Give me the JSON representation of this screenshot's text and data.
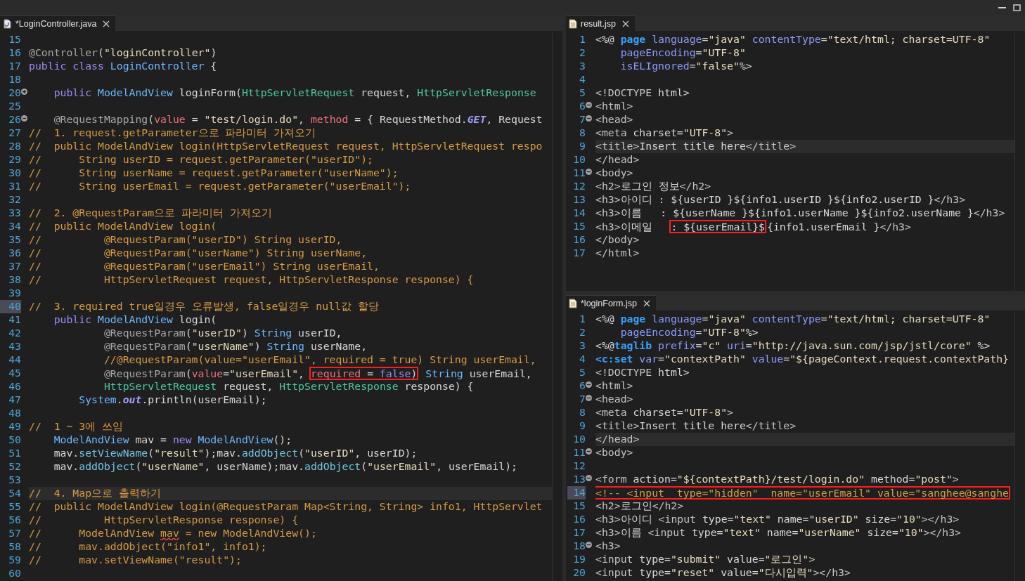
{
  "editors": [
    {
      "tab": {
        "title": "*LoginController.java",
        "kind": "java"
      },
      "lines": [
        {
          "n": "15",
          "kind": "plain",
          "highlighted": false,
          "marked": false
        },
        {
          "n": "16",
          "kind": "plain",
          "highlighted": false,
          "marked": false,
          "tokens": [
            {
              "kind": "annotation",
              "text": "@Controller"
            },
            {
              "kind": "plain",
              "text": "("
            },
            {
              "kind": "string",
              "text": "\"loginController\""
            },
            {
              "kind": "plain",
              "text": ")"
            }
          ]
        },
        {
          "n": "17",
          "kind": "plain",
          "highlighted": false,
          "marked": false,
          "tokens": [
            {
              "kind": "keyword",
              "text": "public class"
            },
            {
              "kind": "type",
              "text": " LoginController"
            },
            {
              "kind": "plain",
              "text": " {"
            }
          ]
        },
        {
          "n": "18",
          "kind": "plain",
          "highlighted": false,
          "marked": false
        },
        {
          "n": "20",
          "kind": "folded",
          "highlighted": false,
          "marked": false,
          "tokens": [
            {
              "kind": "keyword",
              "text": "    public"
            },
            {
              "kind": "type",
              "text": " ModelAndView"
            },
            {
              "kind": "plain",
              "text": " loginForm("
            },
            {
              "kind": "iface",
              "text": "HttpServletRequest"
            },
            {
              "kind": "plain",
              "text": " request, "
            },
            {
              "kind": "iface",
              "text": "HttpServletResponse"
            }
          ]
        },
        {
          "n": "25",
          "kind": "plain",
          "highlighted": false,
          "marked": false
        },
        {
          "n": "26",
          "kind": "foldable",
          "highlighted": false,
          "marked": false,
          "tokens": [
            {
              "kind": "annotation",
              "text": "    @RequestMapping"
            },
            {
              "kind": "plain",
              "text": "("
            },
            {
              "kind": "param",
              "text": "value"
            },
            {
              "kind": "plain",
              "text": " = "
            },
            {
              "kind": "string",
              "text": "\"test/login.do\""
            },
            {
              "kind": "plain",
              "text": ", "
            },
            {
              "kind": "param",
              "text": "method"
            },
            {
              "kind": "plain",
              "text": " = { RequestMethod."
            },
            {
              "kind": "field",
              "text": "GET"
            },
            {
              "kind": "plain",
              "text": ", Request"
            }
          ]
        },
        {
          "n": "27",
          "kind": "plain",
          "highlighted": false,
          "marked": false,
          "tokens": [
            {
              "kind": "comment",
              "text": "//  1. request.getParameter으로 파라미터 가져오기"
            }
          ]
        },
        {
          "n": "28",
          "kind": "plain",
          "highlighted": false,
          "marked": false,
          "tokens": [
            {
              "kind": "comment",
              "text": "//  public ModelAndView login(HttpServletRequest request, HttpServletRequest respo"
            }
          ]
        },
        {
          "n": "29",
          "kind": "plain",
          "highlighted": false,
          "marked": false,
          "tokens": [
            {
              "kind": "comment",
              "text": "//      String userID = request.getParameter(\"userID\");"
            }
          ]
        },
        {
          "n": "30",
          "kind": "plain",
          "highlighted": false,
          "marked": false,
          "tokens": [
            {
              "kind": "comment",
              "text": "//      String userName = request.getParameter(\"userName\");"
            }
          ]
        },
        {
          "n": "31",
          "kind": "plain",
          "highlighted": false,
          "marked": false,
          "tokens": [
            {
              "kind": "comment",
              "text": "//      String userEmail = request.getParameter(\"userEmail\");"
            }
          ]
        },
        {
          "n": "32",
          "kind": "plain",
          "highlighted": false,
          "marked": false
        },
        {
          "n": "33",
          "kind": "plain",
          "highlighted": false,
          "marked": false,
          "tokens": [
            {
              "kind": "comment",
              "text": "//  2. @RequestParam으로 파라미터 가져오기"
            }
          ]
        },
        {
          "n": "34",
          "kind": "plain",
          "highlighted": false,
          "marked": false,
          "tokens": [
            {
              "kind": "comment",
              "text": "//  public ModelAndView login("
            }
          ]
        },
        {
          "n": "35",
          "kind": "plain",
          "highlighted": false,
          "marked": false,
          "tokens": [
            {
              "kind": "comment",
              "text": "//          @RequestParam(\"userID\") String userID,"
            }
          ]
        },
        {
          "n": "36",
          "kind": "plain",
          "highlighted": false,
          "marked": false,
          "tokens": [
            {
              "kind": "comment",
              "text": "//          @RequestParam(\"userName\") String userName,"
            }
          ]
        },
        {
          "n": "37",
          "kind": "plain",
          "highlighted": false,
          "marked": false,
          "tokens": [
            {
              "kind": "comment",
              "text": "//          @RequestParam(\"userEmail\") String userEmail,"
            }
          ]
        },
        {
          "n": "38",
          "kind": "plain",
          "highlighted": false,
          "marked": false,
          "tokens": [
            {
              "kind": "comment",
              "text": "//          HttpServletRequest request, HttpServletResponse response) {"
            }
          ]
        },
        {
          "n": "39",
          "kind": "plain",
          "highlighted": false,
          "marked": false
        },
        {
          "n": "40",
          "kind": "plain",
          "highlighted": false,
          "marked": true,
          "tokens": [
            {
              "kind": "comment",
              "text": "//  3. required true일경우 오류발생, false일경우 null값 할당"
            }
          ]
        },
        {
          "n": "41",
          "kind": "plain",
          "highlighted": false,
          "marked": false,
          "tokens": [
            {
              "kind": "keyword",
              "text": "    public"
            },
            {
              "kind": "type",
              "text": " ModelAndView"
            },
            {
              "kind": "plain",
              "text": " login("
            }
          ]
        },
        {
          "n": "42",
          "kind": "plain",
          "highlighted": false,
          "marked": false,
          "tokens": [
            {
              "kind": "annotation",
              "text": "            @RequestParam"
            },
            {
              "kind": "plain",
              "text": "("
            },
            {
              "kind": "string",
              "text": "\"userID\""
            },
            {
              "kind": "plain",
              "text": ") "
            },
            {
              "kind": "type",
              "text": "String"
            },
            {
              "kind": "plain",
              "text": " userID,"
            }
          ]
        },
        {
          "n": "43",
          "kind": "plain",
          "highlighted": false,
          "marked": false,
          "tokens": [
            {
              "kind": "annotation",
              "text": "            @RequestParam"
            },
            {
              "kind": "plain",
              "text": "("
            },
            {
              "kind": "string",
              "text": "\"userName\""
            },
            {
              "kind": "plain",
              "text": ") "
            },
            {
              "kind": "type",
              "text": "String"
            },
            {
              "kind": "plain",
              "text": " userName,"
            }
          ]
        },
        {
          "n": "44",
          "kind": "plain",
          "highlighted": false,
          "marked": false,
          "tokens": [
            {
              "kind": "comment",
              "text": "            //@RequestParam(value=\"userEmail\", required = true) String userEmail,"
            }
          ]
        },
        {
          "n": "45",
          "kind": "plain",
          "highlighted": false,
          "marked": false,
          "tokens": [
            {
              "kind": "annotation",
              "text": "            @RequestParam"
            },
            {
              "kind": "plain",
              "text": "("
            },
            {
              "kind": "param",
              "text": "value"
            },
            {
              "kind": "plain",
              "text": "="
            },
            {
              "kind": "string",
              "text": "\"userEmail\""
            },
            {
              "kind": "plain",
              "text": ", "
            },
            {
              "kind": "box",
              "tokens": [
                {
                  "kind": "param",
                  "text": "required"
                },
                {
                  "kind": "plain",
                  "text": " = "
                },
                {
                  "kind": "keyword",
                  "text": "false"
                },
                {
                  "kind": "plain",
                  "text": ")"
                }
              ]
            },
            {
              "kind": "type",
              "text": " String"
            },
            {
              "kind": "plain",
              "text": " userEmail,"
            }
          ]
        },
        {
          "n": "46",
          "kind": "plain",
          "highlighted": false,
          "marked": false,
          "tokens": [
            {
              "kind": "iface",
              "text": "            HttpServletRequest"
            },
            {
              "kind": "plain",
              "text": " request, "
            },
            {
              "kind": "iface",
              "text": "HttpServletResponse"
            },
            {
              "kind": "plain",
              "text": " response) {"
            }
          ]
        },
        {
          "n": "47",
          "kind": "plain",
          "highlighted": false,
          "marked": false,
          "tokens": [
            {
              "kind": "type",
              "text": "        System"
            },
            {
              "kind": "plain",
              "text": "."
            },
            {
              "kind": "field",
              "text": "out"
            },
            {
              "kind": "plain",
              "text": ".println(userEmail);"
            }
          ]
        },
        {
          "n": "48",
          "kind": "plain",
          "highlighted": false,
          "marked": false
        },
        {
          "n": "49",
          "kind": "plain",
          "highlighted": false,
          "marked": false,
          "tokens": [
            {
              "kind": "comment",
              "text": "//  1 ~ 3에 쓰임"
            }
          ]
        },
        {
          "n": "50",
          "kind": "plain",
          "highlighted": false,
          "marked": false,
          "tokens": [
            {
              "kind": "type",
              "text": "    ModelAndView"
            },
            {
              "kind": "plain",
              "text": " mav = "
            },
            {
              "kind": "keyword",
              "text": "new"
            },
            {
              "kind": "type",
              "text": " ModelAndView"
            },
            {
              "kind": "plain",
              "text": "();"
            }
          ]
        },
        {
          "n": "51",
          "kind": "plain",
          "highlighted": false,
          "marked": false,
          "tokens": [
            {
              "kind": "plain",
              "text": "    mav."
            },
            {
              "kind": "method",
              "text": "setViewName"
            },
            {
              "kind": "plain",
              "text": "("
            },
            {
              "kind": "string",
              "text": "\"result\""
            },
            {
              "kind": "plain",
              "text": ");mav."
            },
            {
              "kind": "method",
              "text": "addObject"
            },
            {
              "kind": "plain",
              "text": "("
            },
            {
              "kind": "string",
              "text": "\"userID\""
            },
            {
              "kind": "plain",
              "text": ", userID);"
            }
          ]
        },
        {
          "n": "52",
          "kind": "plain",
          "highlighted": false,
          "marked": false,
          "tokens": [
            {
              "kind": "plain",
              "text": "    mav."
            },
            {
              "kind": "method",
              "text": "addObject"
            },
            {
              "kind": "plain",
              "text": "("
            },
            {
              "kind": "string",
              "text": "\"userName\""
            },
            {
              "kind": "plain",
              "text": ", userName);mav."
            },
            {
              "kind": "method",
              "text": "addObject"
            },
            {
              "kind": "plain",
              "text": "("
            },
            {
              "kind": "string",
              "text": "\"userEmail\""
            },
            {
              "kind": "plain",
              "text": ", userEmail);"
            }
          ]
        },
        {
          "n": "53",
          "kind": "plain",
          "highlighted": false,
          "marked": false
        },
        {
          "n": "54",
          "kind": "plain",
          "highlighted": true,
          "marked": false,
          "tokens": [
            {
              "kind": "comment",
              "text": "//  4. Map으로 출력하기"
            }
          ]
        },
        {
          "n": "55",
          "kind": "plain",
          "highlighted": false,
          "marked": false,
          "tokens": [
            {
              "kind": "comment",
              "text": "//  public ModelAndView login(@RequestParam Map<String, String> info1, HttpServlet"
            }
          ]
        },
        {
          "n": "56",
          "kind": "plain",
          "highlighted": false,
          "marked": false,
          "tokens": [
            {
              "kind": "comment",
              "text": "//          HttpServletResponse response) {"
            }
          ]
        },
        {
          "n": "57",
          "kind": "plain",
          "highlighted": false,
          "marked": false,
          "tokens": [
            {
              "kind": "comment",
              "text": "//      ModelAndView "
            },
            {
              "kind": "squiggle",
              "text": "mav"
            },
            {
              "kind": "comment",
              "text": " = new ModelAndView();"
            }
          ]
        },
        {
          "n": "58",
          "kind": "plain",
          "highlighted": false,
          "marked": false,
          "tokens": [
            {
              "kind": "comment",
              "text": "//      mav.addObject(\"info1\", info1);"
            }
          ]
        },
        {
          "n": "59",
          "kind": "plain",
          "highlighted": false,
          "marked": false,
          "tokens": [
            {
              "kind": "comment",
              "text": "//      mav.setViewName(\"result\");"
            }
          ]
        },
        {
          "n": "60",
          "kind": "plain",
          "highlighted": false,
          "marked": false
        }
      ]
    },
    {
      "tab": {
        "title": "result.jsp",
        "kind": "jsp"
      },
      "lines": [
        {
          "n": "1",
          "kind": "plain",
          "highlighted": false,
          "marked": false,
          "tokens": [
            {
              "kind": "plain",
              "text": "<%@ "
            },
            {
              "kind": "directive",
              "text": "page"
            },
            {
              "kind": "attr",
              "text": " language"
            },
            {
              "kind": "plain",
              "text": "="
            },
            {
              "kind": "string",
              "text": "\"java\""
            },
            {
              "kind": "attr",
              "text": " contentType"
            },
            {
              "kind": "plain",
              "text": "="
            },
            {
              "kind": "string",
              "text": "\"text/html; charset=UTF-8\""
            }
          ]
        },
        {
          "n": "2",
          "kind": "plain",
          "highlighted": false,
          "marked": false,
          "tokens": [
            {
              "kind": "attr",
              "text": "    pageEncoding"
            },
            {
              "kind": "plain",
              "text": "="
            },
            {
              "kind": "string",
              "text": "\"UTF-8\""
            }
          ]
        },
        {
          "n": "3",
          "kind": "plain",
          "highlighted": false,
          "marked": false,
          "tokens": [
            {
              "kind": "attr",
              "text": "    isELIgnored"
            },
            {
              "kind": "plain",
              "text": "="
            },
            {
              "kind": "string",
              "text": "\"false\""
            },
            {
              "kind": "plain",
              "text": "%>"
            }
          ]
        },
        {
          "n": "4",
          "kind": "plain",
          "highlighted": false,
          "marked": false
        },
        {
          "n": "5",
          "kind": "plain",
          "highlighted": false,
          "marked": false,
          "tokens": [
            {
              "kind": "tag",
              "text": "<!DOCTYPE"
            },
            {
              "kind": "plain",
              "text": " html>"
            }
          ]
        },
        {
          "n": "6",
          "kind": "foldable",
          "highlighted": false,
          "marked": false,
          "tokens": [
            {
              "kind": "tag",
              "text": "<html>"
            }
          ]
        },
        {
          "n": "7",
          "kind": "foldable",
          "highlighted": false,
          "marked": false,
          "tokens": [
            {
              "kind": "tag",
              "text": "<head>"
            }
          ]
        },
        {
          "n": "8",
          "kind": "plain",
          "highlighted": false,
          "marked": false,
          "tokens": [
            {
              "kind": "tag",
              "text": "<meta"
            },
            {
              "kind": "plain",
              "text": " charset="
            },
            {
              "kind": "string",
              "text": "\"UTF-8\""
            },
            {
              "kind": "tag",
              "text": ">"
            }
          ]
        },
        {
          "n": "9",
          "kind": "plain",
          "highlighted": true,
          "marked": false,
          "tokens": [
            {
              "kind": "tag",
              "text": "<title>"
            },
            {
              "kind": "plain",
              "text": "Insert title here"
            },
            {
              "kind": "tag",
              "text": "</title>"
            }
          ]
        },
        {
          "n": "10",
          "kind": "plain",
          "highlighted": false,
          "marked": false,
          "tokens": [
            {
              "kind": "tag",
              "text": "</head>"
            }
          ]
        },
        {
          "n": "11",
          "kind": "foldable",
          "highlighted": false,
          "marked": false,
          "tokens": [
            {
              "kind": "tag",
              "text": "<body>"
            }
          ]
        },
        {
          "n": "12",
          "kind": "plain",
          "highlighted": false,
          "marked": false,
          "tokens": [
            {
              "kind": "tag",
              "text": "<h2>"
            },
            {
              "kind": "plain",
              "text": "로그인 정보"
            },
            {
              "kind": "tag",
              "text": "</h2>"
            }
          ]
        },
        {
          "n": "13",
          "kind": "plain",
          "highlighted": false,
          "marked": false,
          "tokens": [
            {
              "kind": "tag",
              "text": "<h3>"
            },
            {
              "kind": "plain",
              "text": "아이디 : ${userID }${info1.userID }${info2.userID }"
            },
            {
              "kind": "tag",
              "text": "</h3>"
            }
          ]
        },
        {
          "n": "14",
          "kind": "plain",
          "highlighted": false,
          "marked": false,
          "tokens": [
            {
              "kind": "tag",
              "text": "<h3>"
            },
            {
              "kind": "plain",
              "text": "이름   : ${userName }${info1.userName }${info2.userName }"
            },
            {
              "kind": "tag",
              "text": "</h3>"
            }
          ]
        },
        {
          "n": "15",
          "kind": "plain",
          "highlighted": false,
          "marked": false,
          "tokens": [
            {
              "kind": "tag",
              "text": "<h3>"
            },
            {
              "kind": "plain",
              "text": "이메일   "
            },
            {
              "kind": "box",
              "tokens": [
                {
                  "kind": "plain",
                  "text": ": ${userEmail}$"
                }
              ]
            },
            {
              "kind": "plain",
              "text": "{info1.userEmail }"
            },
            {
              "kind": "tag",
              "text": "</h3>"
            }
          ]
        },
        {
          "n": "16",
          "kind": "plain",
          "highlighted": false,
          "marked": false,
          "tokens": [
            {
              "kind": "tag",
              "text": "</body>"
            }
          ]
        },
        {
          "n": "17",
          "kind": "plain",
          "highlighted": false,
          "marked": false,
          "tokens": [
            {
              "kind": "tag",
              "text": "</html>"
            }
          ]
        }
      ]
    },
    {
      "tab": {
        "title": "*loginForm.jsp",
        "kind": "jsp"
      },
      "lines": [
        {
          "n": "1",
          "kind": "plain",
          "highlighted": false,
          "marked": false,
          "tokens": [
            {
              "kind": "plain",
              "text": "<%@ "
            },
            {
              "kind": "directive",
              "text": "page"
            },
            {
              "kind": "attr",
              "text": " language"
            },
            {
              "kind": "plain",
              "text": "="
            },
            {
              "kind": "string",
              "text": "\"java\""
            },
            {
              "kind": "attr",
              "text": " contentType"
            },
            {
              "kind": "plain",
              "text": "="
            },
            {
              "kind": "string",
              "text": "\"text/html; charset=UTF-8\""
            }
          ]
        },
        {
          "n": "2",
          "kind": "plain",
          "highlighted": false,
          "marked": false,
          "tokens": [
            {
              "kind": "attr",
              "text": "    pageEncoding"
            },
            {
              "kind": "plain",
              "text": "="
            },
            {
              "kind": "string",
              "text": "\"UTF-8\""
            },
            {
              "kind": "plain",
              "text": "%>"
            }
          ]
        },
        {
          "n": "3",
          "kind": "plain",
          "highlighted": false,
          "marked": false,
          "tokens": [
            {
              "kind": "plain",
              "text": "<%@"
            },
            {
              "kind": "directive",
              "text": "taglib"
            },
            {
              "kind": "attr",
              "text": " prefix"
            },
            {
              "kind": "plain",
              "text": "="
            },
            {
              "kind": "string",
              "text": "\"c\""
            },
            {
              "kind": "attr",
              "text": " uri"
            },
            {
              "kind": "plain",
              "text": "="
            },
            {
              "kind": "string",
              "text": "\"http://java.sun.com/jsp/jstl/core\""
            },
            {
              "kind": "plain",
              "text": " %>"
            }
          ]
        },
        {
          "n": "4",
          "kind": "plain",
          "highlighted": false,
          "marked": false,
          "tokens": [
            {
              "kind": "directive",
              "text": "<c:set"
            },
            {
              "kind": "attr",
              "text": " var"
            },
            {
              "kind": "plain",
              "text": "="
            },
            {
              "kind": "string",
              "text": "\"contextPath\""
            },
            {
              "kind": "attr",
              "text": " value"
            },
            {
              "kind": "plain",
              "text": "="
            },
            {
              "kind": "string",
              "text": "\"${pageContext.request.contextPath}"
            }
          ]
        },
        {
          "n": "5",
          "kind": "plain",
          "highlighted": false,
          "marked": false,
          "tokens": [
            {
              "kind": "tag",
              "text": "<!DOCTYPE"
            },
            {
              "kind": "plain",
              "text": " html>"
            }
          ]
        },
        {
          "n": "6",
          "kind": "foldable",
          "highlighted": false,
          "marked": false,
          "tokens": [
            {
              "kind": "tag",
              "text": "<html>"
            }
          ]
        },
        {
          "n": "7",
          "kind": "foldable",
          "highlighted": false,
          "marked": false,
          "tokens": [
            {
              "kind": "tag",
              "text": "<head>"
            }
          ]
        },
        {
          "n": "8",
          "kind": "plain",
          "highlighted": false,
          "marked": false,
          "tokens": [
            {
              "kind": "tag",
              "text": "<meta"
            },
            {
              "kind": "plain",
              "text": " charset="
            },
            {
              "kind": "string",
              "text": "\"UTF-8\""
            },
            {
              "kind": "tag",
              "text": ">"
            }
          ]
        },
        {
          "n": "9",
          "kind": "plain",
          "highlighted": false,
          "marked": false,
          "tokens": [
            {
              "kind": "tag",
              "text": "<title>"
            },
            {
              "kind": "plain",
              "text": "Insert title here"
            },
            {
              "kind": "tag",
              "text": "</title>"
            }
          ]
        },
        {
          "n": "10",
          "kind": "plain",
          "highlighted": true,
          "marked": false,
          "tokens": [
            {
              "kind": "tag",
              "text": "</head>"
            }
          ]
        },
        {
          "n": "11",
          "kind": "foldable",
          "highlighted": false,
          "marked": false,
          "tokens": [
            {
              "kind": "tag",
              "text": "<body>"
            }
          ]
        },
        {
          "n": "12",
          "kind": "plain",
          "highlighted": false,
          "marked": false
        },
        {
          "n": "13",
          "kind": "foldable",
          "highlighted": false,
          "marked": false,
          "tokens": [
            {
              "kind": "tag",
              "text": "<form"
            },
            {
              "kind": "plain",
              "text": " action="
            },
            {
              "kind": "string",
              "text": "\"${contextPath}/test/login.do\""
            },
            {
              "kind": "plain",
              "text": " method="
            },
            {
              "kind": "string",
              "text": "\"post\""
            },
            {
              "kind": "tag",
              "text": ">"
            }
          ]
        },
        {
          "n": "14",
          "kind": "plain",
          "highlighted": false,
          "marked": true,
          "tokens": [
            {
              "kind": "box",
              "tokens": [
                {
                  "kind": "comment",
                  "text": "<!-- <input  type=\"hidden\"  name=\"userEmail\" value=\"sanghee@sanghe"
                }
              ]
            }
          ]
        },
        {
          "n": "15",
          "kind": "plain",
          "highlighted": false,
          "marked": false,
          "tokens": [
            {
              "kind": "tag",
              "text": "<h2>"
            },
            {
              "kind": "plain",
              "text": "로그인"
            },
            {
              "kind": "tag",
              "text": "</h2>"
            }
          ]
        },
        {
          "n": "16",
          "kind": "plain",
          "highlighted": false,
          "marked": false,
          "tokens": [
            {
              "kind": "tag",
              "text": "<h3>"
            },
            {
              "kind": "plain",
              "text": "아이디 "
            },
            {
              "kind": "tag",
              "text": "<input"
            },
            {
              "kind": "plain",
              "text": " type="
            },
            {
              "kind": "string",
              "text": "\"text\""
            },
            {
              "kind": "plain",
              "text": " name="
            },
            {
              "kind": "string",
              "text": "\"userID\""
            },
            {
              "kind": "plain",
              "text": " size="
            },
            {
              "kind": "string",
              "text": "\"10\""
            },
            {
              "kind": "tag",
              "text": "></h3>"
            }
          ]
        },
        {
          "n": "17",
          "kind": "plain",
          "highlighted": false,
          "marked": false,
          "tokens": [
            {
              "kind": "tag",
              "text": "<h3>"
            },
            {
              "kind": "plain",
              "text": "이름 "
            },
            {
              "kind": "tag",
              "text": "<input"
            },
            {
              "kind": "plain",
              "text": " type="
            },
            {
              "kind": "string",
              "text": "\"text\""
            },
            {
              "kind": "plain",
              "text": " name="
            },
            {
              "kind": "string",
              "text": "\"userName\""
            },
            {
              "kind": "plain",
              "text": " size="
            },
            {
              "kind": "string",
              "text": "\"10\""
            },
            {
              "kind": "tag",
              "text": "></h3>"
            }
          ]
        },
        {
          "n": "18",
          "kind": "foldable",
          "highlighted": false,
          "marked": false,
          "tokens": [
            {
              "kind": "tag",
              "text": "<h3>"
            }
          ]
        },
        {
          "n": "19",
          "kind": "plain",
          "highlighted": false,
          "marked": false,
          "tokens": [
            {
              "kind": "tag",
              "text": "<input"
            },
            {
              "kind": "plain",
              "text": " type="
            },
            {
              "kind": "string",
              "text": "\"submit\""
            },
            {
              "kind": "plain",
              "text": " value="
            },
            {
              "kind": "string",
              "text": "\"로그인\""
            },
            {
              "kind": "tag",
              "text": ">"
            }
          ]
        },
        {
          "n": "20",
          "kind": "plain",
          "highlighted": false,
          "marked": false,
          "tokens": [
            {
              "kind": "tag",
              "text": "<input"
            },
            {
              "kind": "plain",
              "text": " type="
            },
            {
              "kind": "string",
              "text": "\"reset\""
            },
            {
              "kind": "plain",
              "text": " value="
            },
            {
              "kind": "string",
              "text": "\"다시입력\""
            },
            {
              "kind": "tag",
              "text": "></h3>"
            }
          ]
        }
      ]
    }
  ]
}
